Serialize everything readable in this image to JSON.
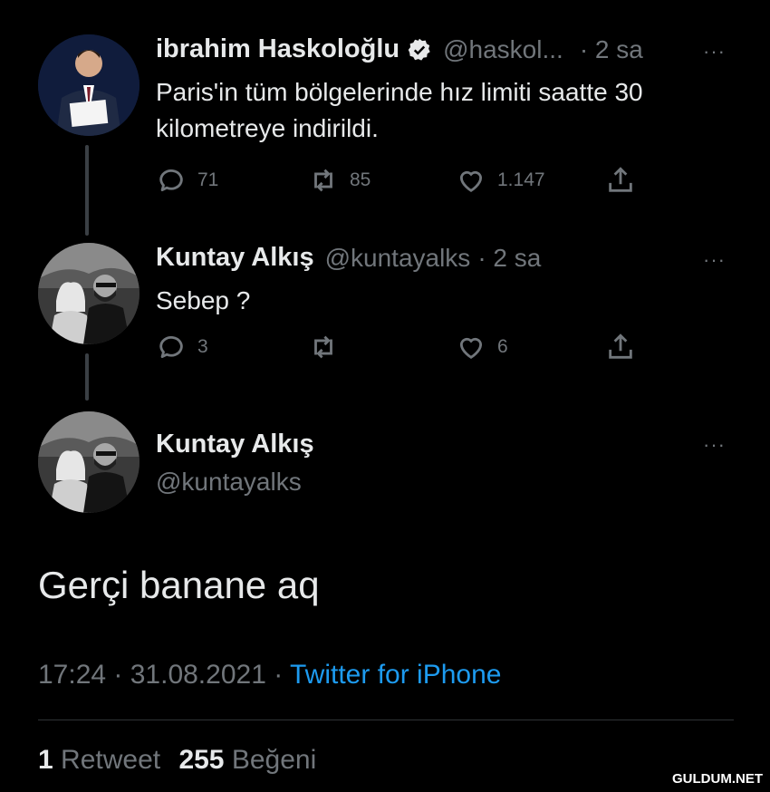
{
  "tweet1": {
    "name": "ibrahim Haskoloğlu",
    "handle": "@haskol...",
    "time": "· 2 sa",
    "text_line1": "Paris'in tüm bölgelerinde hız limiti saatte 30",
    "text_line2": "kilometreye indirildi.",
    "replies": "71",
    "retweets": "85",
    "likes": "1.147",
    "more": "···"
  },
  "tweet2": {
    "name": "Kuntay Alkış",
    "handle": "@kuntayalks",
    "time": "· 2 sa",
    "text": "Sebep ?",
    "replies": "3",
    "likes": "6",
    "more": "···"
  },
  "main": {
    "name": "Kuntay Alkış",
    "handle": "@kuntayalks",
    "text": "Gerçi banane aq",
    "timestamp": "17:24 · 31.08.2021 ·",
    "source": "Twitter for iPhone",
    "more": "···"
  },
  "stats": {
    "retweet_count": "1",
    "retweet_label": "Retweet",
    "like_count": "255",
    "like_label": "Beğeni"
  },
  "watermark": "GULDUM.NET",
  "colors": {
    "background": "#000000",
    "text": "#e7e9ea",
    "muted": "#71767b",
    "link": "#1d9bf0"
  }
}
